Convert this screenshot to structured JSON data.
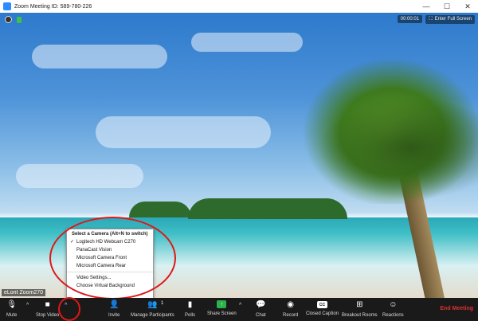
{
  "window": {
    "title": "Zoom Meeting ID: 589-780-226",
    "controls": [
      "—",
      "☐",
      "✕"
    ]
  },
  "video": {
    "timer": "00:00:01",
    "fullscreen_label": "Enter Full Screen",
    "participant_name": "eLont Zoom270"
  },
  "camera_menu": {
    "header": "Select a Camera (Alt+N to switch)",
    "cameras": [
      {
        "label": "Logitech HD Webcam C270",
        "checked": true
      },
      {
        "label": "PanaCast Vision",
        "checked": false
      },
      {
        "label": "Microsoft Camera Front",
        "checked": false
      },
      {
        "label": "Microsoft Camera Rear",
        "checked": false
      }
    ],
    "video_settings": "Video Settings...",
    "virtual_background": "Choose Virtual Background"
  },
  "toolbar": {
    "mute": "Mute",
    "stop_video": "Stop Video",
    "invite": "Invite",
    "manage_participants": "Manage Participants",
    "participant_count": "1",
    "polls": "Polls",
    "share_screen": "Share Screen",
    "chat": "Chat",
    "record": "Record",
    "closed_caption": "Closed Caption",
    "breakout_rooms": "Breakout Rooms",
    "reactions": "Reactions",
    "end_meeting": "End Meeting",
    "cc_glyph": "CC"
  },
  "colors": {
    "zoom_blue": "#2D8CFF",
    "share_green": "#2bb24a",
    "end_red": "#e03030",
    "toolbar_bg": "#1a1a1a"
  }
}
